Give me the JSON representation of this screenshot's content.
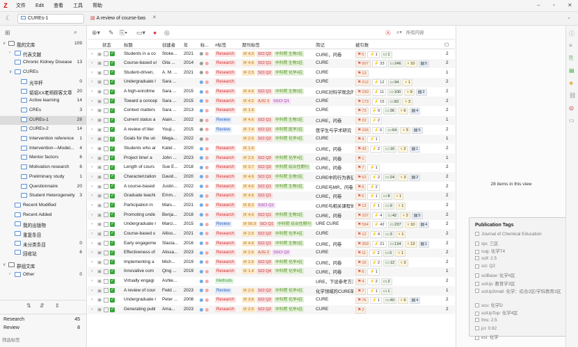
{
  "app": {
    "menus": [
      "文件",
      "Edit",
      "查看",
      "工具",
      "帮助"
    ],
    "tab_collection": "CUREs-1",
    "tab_doc": "A review of course-bas"
  },
  "sidebar": {
    "collections": [
      {
        "label": "我的文库",
        "count": "109",
        "indent": 0,
        "arrow": "∨",
        "kind": "lib"
      },
      {
        "label": "代表文献",
        "count": "",
        "indent": 1,
        "arrow": "›",
        "kind": "folder"
      },
      {
        "label": "Chronic Kidney Disease",
        "count": "13",
        "indent": 1,
        "arrow": "",
        "kind": "folder"
      },
      {
        "label": "CUREs",
        "count": "",
        "indent": 1,
        "arrow": "∨",
        "kind": "folder"
      },
      {
        "label": "光华杯",
        "count": "0",
        "indent": 2,
        "arrow": "",
        "kind": "folder"
      },
      {
        "label": "韬韬XX老师顾客文章",
        "count": "20",
        "indent": 2,
        "arrow": "",
        "kind": "folder"
      },
      {
        "label": "Active learning",
        "count": "14",
        "indent": 2,
        "arrow": "",
        "kind": "folder"
      },
      {
        "label": "CREs",
        "count": "3",
        "indent": 2,
        "arrow": "",
        "kind": "folder"
      },
      {
        "label": "CUREs-1",
        "count": "28",
        "indent": 2,
        "arrow": "",
        "kind": "folder",
        "selected": true
      },
      {
        "label": "CUREs-2",
        "count": "14",
        "indent": 2,
        "arrow": "",
        "kind": "folder"
      },
      {
        "label": "Intervention reference",
        "count": "1",
        "indent": 2,
        "arrow": "",
        "kind": "folder"
      },
      {
        "label": "Intervention---Model...",
        "count": "4",
        "indent": 2,
        "arrow": "",
        "kind": "folder"
      },
      {
        "label": "Mentor factors",
        "count": "6",
        "indent": 2,
        "arrow": "",
        "kind": "folder"
      },
      {
        "label": "Motivation research",
        "count": "6",
        "indent": 2,
        "arrow": "",
        "kind": "folder"
      },
      {
        "label": "Preliminary study",
        "count": "1",
        "indent": 2,
        "arrow": "",
        "kind": "folder"
      },
      {
        "label": "Questionnaire",
        "count": "20",
        "indent": 2,
        "arrow": "",
        "kind": "folder"
      },
      {
        "label": "Student Heterogeneity",
        "count": "3",
        "indent": 2,
        "arrow": "",
        "kind": "folder"
      },
      {
        "label": "Recent Modified",
        "count": "",
        "indent": 1,
        "arrow": "",
        "kind": "folder"
      },
      {
        "label": "Recent Added",
        "count": "",
        "indent": 1,
        "arrow": "",
        "kind": "folder"
      },
      {
        "label": "我的出版物",
        "count": "",
        "indent": 1,
        "arrow": "",
        "kind": "folder"
      },
      {
        "label": "重复条目",
        "count": "",
        "indent": 1,
        "arrow": "",
        "kind": "folder"
      },
      {
        "label": "未分类条目",
        "count": "0",
        "indent": 1,
        "arrow": "",
        "kind": "folder"
      },
      {
        "label": "回收站",
        "count": "6",
        "indent": 1,
        "arrow": "",
        "kind": "folder"
      },
      {
        "label": "群组文库",
        "count": "",
        "indent": 0,
        "arrow": "∨",
        "kind": "lib"
      },
      {
        "label": "Other",
        "count": "0",
        "indent": 1,
        "arrow": "›",
        "kind": "folder"
      }
    ],
    "tags": [
      {
        "label": "Research",
        "count": "45"
      },
      {
        "label": "Review",
        "count": "8"
      }
    ],
    "filter_placeholder": "筛选标签"
  },
  "table": {
    "headers": {
      "status": "状态",
      "title": "标题",
      "creator": "创建者",
      "year": "年",
      "mark": "标...",
      "tags": "#标签",
      "journal": "期刊标签",
      "note": "简记",
      "cite": "被引数"
    },
    "rows": [
      {
        "title": "Students in a co",
        "creator": "Stoke...",
        "year": "2021",
        "dot": "grey",
        "tags": [
          "Research"
        ],
        "journal": [
          [
            "IF 4.0",
            "if"
          ],
          [
            "SCI Q2",
            "sci"
          ],
          [
            "中科院 生物3区",
            "zk"
          ]
        ],
        "note": "CURE，问卷",
        "cites": [
          "5",
          "1",
          "1"
        ],
        "count": "2"
      },
      {
        "title": "Course-based ur",
        "creator": "Gita ...",
        "year": "2014",
        "dot": "grey",
        "tags": [
          "Research"
        ],
        "journal": [
          [
            "IF 4.6",
            "if"
          ],
          [
            "SCI Q1",
            "sci"
          ],
          [
            "中科院 生物3区",
            "zk"
          ]
        ],
        "note": "CURE",
        "cites": [
          "507",
          "33",
          "246",
          "10",
          "5"
        ],
        "count": "2"
      },
      {
        "title": "Student-driven,",
        "creator": "A. M. ...",
        "year": "2021",
        "dot": "grey",
        "tags": [
          "Research"
        ],
        "journal": [
          [
            "IF 2.5",
            "if"
          ],
          [
            "SCI Q2",
            "sci"
          ],
          [
            "中科院 化学4区",
            "zk"
          ]
        ],
        "note": "CURE",
        "cites": [
          "13"
        ],
        "count": "1"
      },
      {
        "title": "Undergraduate l",
        "creator": "Sara ...",
        "year": "",
        "dot": "blue",
        "tags": [
          "Research"
        ],
        "journal": [],
        "note": "CURE",
        "cites": [
          "212",
          "12",
          "94",
          "1"
        ],
        "count": "2"
      },
      {
        "title": "A high-enrollme",
        "creator": "Sara ...",
        "year": "2015",
        "dot": "blue",
        "tags": [
          "Research"
        ],
        "journal": [
          [
            "IF 4.6",
            "if"
          ],
          [
            "SCI Q1",
            "sci"
          ],
          [
            "中科院 生物3区",
            "zk"
          ]
        ],
        "note": "CURE对科学观念的",
        "cites": [
          "230",
          "11",
          "100",
          "9",
          "2"
        ],
        "count": "2"
      },
      {
        "title": "Toward a concep",
        "creator": "Sara ...",
        "year": "2015",
        "dot": "blue",
        "tags": [
          "Research"
        ],
        "journal": [
          [
            "IF 4.2",
            "if"
          ],
          [
            "AJG 3",
            "aj"
          ],
          [
            "SSCI Q1",
            "ssci"
          ]
        ],
        "note": "CURE",
        "cites": [
          "173",
          "15",
          "82",
          "3"
        ],
        "count": "2"
      },
      {
        "title": "Context matters",
        "creator": "Sara ...",
        "year": "2013",
        "dot": "blue",
        "tags": [
          "Research"
        ],
        "journal": [
          [
            "IF 1.6",
            "if"
          ]
        ],
        "note": "CURE",
        "cites": [
          "73",
          "9",
          "36",
          "6",
          "4"
        ],
        "count": "2"
      },
      {
        "title": "Current status a",
        "creator": "Alain...",
        "year": "2022",
        "dot": "grey",
        "tags": [
          "Review"
        ],
        "journal": [
          [
            "IF 4.6",
            "if"
          ],
          [
            "SCI Q1",
            "sci"
          ],
          [
            "中科院 生物3区",
            "zk"
          ]
        ],
        "note": "CURE，问卷",
        "cites": [
          "22",
          "2"
        ],
        "count": "1"
      },
      {
        "title": "A review of liter",
        "creator": "Youji...",
        "year": "2015",
        "dot": "grey",
        "tags": [
          "Review"
        ],
        "journal": [
          [
            "IF 7.4",
            "if"
          ],
          [
            "SCI Q1",
            "sci"
          ],
          [
            "中科院 医学2区",
            "zk"
          ]
        ],
        "note": "医学生与学术研究",
        "cites": [
          "156",
          "6",
          "64",
          "3",
          "5"
        ],
        "count": "2"
      },
      {
        "title": "Goals for the un",
        "creator": "Mega...",
        "year": "2022",
        "dot": "grey",
        "tags": [],
        "journal": [
          [
            "IF 2.5",
            "if"
          ],
          [
            "SCI Q2",
            "sci"
          ],
          [
            "中科院 化学4区",
            "zk"
          ]
        ],
        "note": "CURE",
        "cites": [
          "9",
          "1"
        ],
        "count": "1"
      },
      {
        "title": "Students who ar",
        "creator": "Katel...",
        "year": "2020",
        "dot": "blue",
        "tags": [
          "Research"
        ],
        "journal": [
          [
            "IF 1.6",
            "if"
          ]
        ],
        "note": "CURE，问卷",
        "cites": [
          "42",
          "2",
          "16",
          "2",
          "1"
        ],
        "count": "2"
      },
      {
        "title": "Project time! a",
        "creator": "John ...",
        "year": "2023",
        "dot": "blue",
        "tags": [
          "Research"
        ],
        "journal": [
          [
            "IF 2.5",
            "if"
          ],
          [
            "SCI Q2",
            "sci"
          ],
          [
            "中科院 化学4区",
            "zk"
          ]
        ],
        "note": "CURE，问卷",
        "cites": [
          "1"
        ],
        "count": "1"
      },
      {
        "title": "Length of cours",
        "creator": "Sue E...",
        "year": "2018",
        "dot": "blue",
        "tags": [
          "Research"
        ],
        "journal": [
          [
            "IF 3.7",
            "if"
          ],
          [
            "SCI Q2",
            "sci"
          ],
          [
            "中科院 综合性期刊",
            "zk"
          ]
        ],
        "note": "CURE，问卷",
        "cites": [
          "7",
          "1"
        ],
        "count": "2"
      },
      {
        "title": "Characterization",
        "creator": "David...",
        "year": "2020",
        "dot": "blue",
        "tags": [
          "Research"
        ],
        "journal": [
          [
            "IF 4.6",
            "if"
          ],
          [
            "SCI Q1",
            "sci"
          ],
          [
            "中科院 生物3区",
            "zk"
          ]
        ],
        "note": "CURE中的行为表征",
        "cites": [
          "52",
          "2",
          "24",
          "3",
          "2"
        ],
        "count": "2"
      },
      {
        "title": "A course-based",
        "creator": "Justin...",
        "year": "2022",
        "dot": "blue",
        "tags": [
          "Research"
        ],
        "journal": [
          [
            "IF 4.6",
            "if"
          ],
          [
            "SCI Q1",
            "sci"
          ],
          [
            "中科院 生物3区",
            "zk"
          ]
        ],
        "note": "CURE与MR，问卷",
        "cites": [
          "6",
          "2"
        ],
        "count": "2"
      },
      {
        "title": "Graduate teachi",
        "creator": "Emm...",
        "year": "2015",
        "dot": "blue",
        "tags": [
          "Research"
        ],
        "journal": [
          [
            "IF 4.6",
            "if"
          ],
          [
            "SCI Q1",
            "sci"
          ]
        ],
        "note": "CURE，问卷",
        "cites": [
          "6",
          "1",
          "8",
          "1"
        ],
        "count": "2"
      },
      {
        "title": "Participation in",
        "creator": "Mars...",
        "year": "2021",
        "dot": "blue",
        "tags": [
          "Research"
        ],
        "journal": [
          [
            "IF 8.2",
            "if"
          ],
          [
            "SSCI Q1",
            "ssci"
          ]
        ],
        "note": "CURE与相关课程体",
        "cites": [
          "13",
          "1",
          "9",
          "1"
        ],
        "count": "2"
      },
      {
        "title": "Promoting unde",
        "creator": "Benja...",
        "year": "2018",
        "dot": "blue",
        "tags": [
          "Research"
        ],
        "journal": [
          [
            "IF 4.6",
            "if"
          ],
          [
            "SCI Q1",
            "sci"
          ],
          [
            "中科院 生物3区",
            "zk"
          ]
        ],
        "note": "CURE，问卷",
        "cites": [
          "107",
          "4",
          "42",
          "2",
          "5"
        ],
        "count": "2"
      },
      {
        "title": "Undergraduate r",
        "creator": "Marci...",
        "year": "2015",
        "dot": "blue",
        "tags": [
          "Review"
        ],
        "journal": [
          [
            "IF 56.9",
            "if"
          ],
          [
            "SCI Q1",
            "sci"
          ],
          [
            "中科院 综合性期刊",
            "zk"
          ]
        ],
        "note": "URE CURE",
        "cites": [
          "594",
          "42",
          "237",
          "10",
          "4"
        ],
        "count": "2"
      },
      {
        "title": "Course-based u",
        "creator": "Alliso...",
        "year": "2021",
        "dot": "blue",
        "tags": [
          "Research"
        ],
        "journal": [
          [
            "IF 2.5",
            "if"
          ],
          [
            "SCI Q2",
            "sci"
          ],
          [
            "中科院 化学4区",
            "zk"
          ]
        ],
        "note": "CURE",
        "cites": [
          "12",
          "4",
          "3",
          "1"
        ],
        "count": "2"
      },
      {
        "title": "Early engageme",
        "creator": "Stacia...",
        "year": "2016",
        "dot": "blue",
        "tags": [
          "Research"
        ],
        "journal": [
          [
            "IF 4.6",
            "if"
          ],
          [
            "SCI Q1",
            "sci"
          ],
          [
            "中科院 生物3区",
            "zk"
          ]
        ],
        "note": "CURE，问卷",
        "cites": [
          "309",
          "21",
          "134",
          "13",
          "1"
        ],
        "count": "2"
      },
      {
        "title": "Effectiveness of",
        "creator": "Alissa...",
        "year": "2023",
        "dot": "blue",
        "tags": [
          "Research"
        ],
        "journal": [
          [
            "IF 2.6",
            "if"
          ],
          [
            "AJG 2",
            "aj"
          ],
          [
            "SSCI Q2",
            "ssci"
          ]
        ],
        "note": "CURE",
        "cites": [
          "11",
          "2",
          "5",
          "1"
        ],
        "count": "2"
      },
      {
        "title": "Implementing a",
        "creator": "Mich...",
        "year": "2019",
        "dot": "blue",
        "tags": [
          "Research"
        ],
        "journal": [
          [
            "IF 2.5",
            "if"
          ],
          [
            "SCI Q2",
            "sci"
          ],
          [
            "中科院 化学4区",
            "zk"
          ]
        ],
        "note": "CURE，问卷",
        "cites": [
          "15",
          "2",
          "12",
          "3"
        ],
        "count": "2"
      },
      {
        "title": "Innovative com",
        "creator": "Qing ...",
        "year": "2019",
        "dot": "blue",
        "tags": [
          "Research"
        ],
        "journal": [
          [
            "IF 1.4",
            "if"
          ],
          [
            "SCI Q4",
            "sci"
          ],
          [
            "中科院 化学4区",
            "zk"
          ]
        ],
        "note": "CURE，问卷",
        "cites": [
          "6",
          "1"
        ],
        "count": "1"
      },
      {
        "title": "Virtually engagi",
        "creator": "Ashle...",
        "year": "",
        "dot": "blue",
        "tags": [
          "Methods"
        ],
        "journal": [],
        "note": "URE，下设参考方法",
        "cites": [
          "4",
          "2",
          "2"
        ],
        "count": "2"
      },
      {
        "title": "A review of cour",
        "creator": "Field ...",
        "year": "2023",
        "dot": "blue",
        "tags": [
          "Review"
        ],
        "journal": [
          [
            "IF 2.5",
            "if"
          ],
          [
            "SCI Q2",
            "sci"
          ],
          [
            "中科院 化学4区",
            "zk"
          ]
        ],
        "note": "化学领域的CURE研",
        "cites": [
          "7",
          "1",
          "1"
        ],
        "count": "1"
      },
      {
        "title": "Undergraduate r",
        "creator": "Peter ...",
        "year": "2008",
        "dot": "blue",
        "tags": [
          "Research"
        ],
        "journal": [
          [
            "IF 3.6",
            "if"
          ],
          [
            "SCI Q2",
            "sci"
          ],
          [
            "中科院 化学4区",
            "zk"
          ]
        ],
        "note": "CURE",
        "cites": [
          "76",
          "1",
          "40",
          "6",
          "4"
        ],
        "count": "2"
      },
      {
        "title": "Generating publ",
        "creator": "Ama...",
        "year": "2023",
        "dot": "blue",
        "tags": [
          "Research"
        ],
        "journal": [
          [
            "IF 2.5",
            "if"
          ],
          [
            "SCI Q2",
            "sci"
          ],
          [
            "中科院 化学4区",
            "zk"
          ]
        ],
        "note": "CURE",
        "cites": [
          "2"
        ],
        "count": "2"
      }
    ]
  },
  "toolbar": {
    "search_placeholder": "所有内容"
  },
  "right_panel": {
    "items_text": "28 items in this view",
    "pub_tags_title": "Publication Tags",
    "pub_tags": [
      "Journal of Chemical Education",
      "xju: 三区",
      "cug: 化学T4",
      "scif: 2.5",
      "sci: Q2",
      "sciBase: 化学4区",
      "sciUp: 教育学3区",
      "sciUpSmall: 化学：综合2区/学科教育3区",
      "scu: 化学D",
      "sciUpTop: 化学4区",
      "fms: 2.5",
      "jci: 0.92",
      "esi: 化学"
    ]
  },
  "colors": {
    "accent_red": "#cc2222",
    "check_green": "#3aa53a",
    "dot_blue": "#6fa8e8",
    "dot_grey": "#999999"
  }
}
